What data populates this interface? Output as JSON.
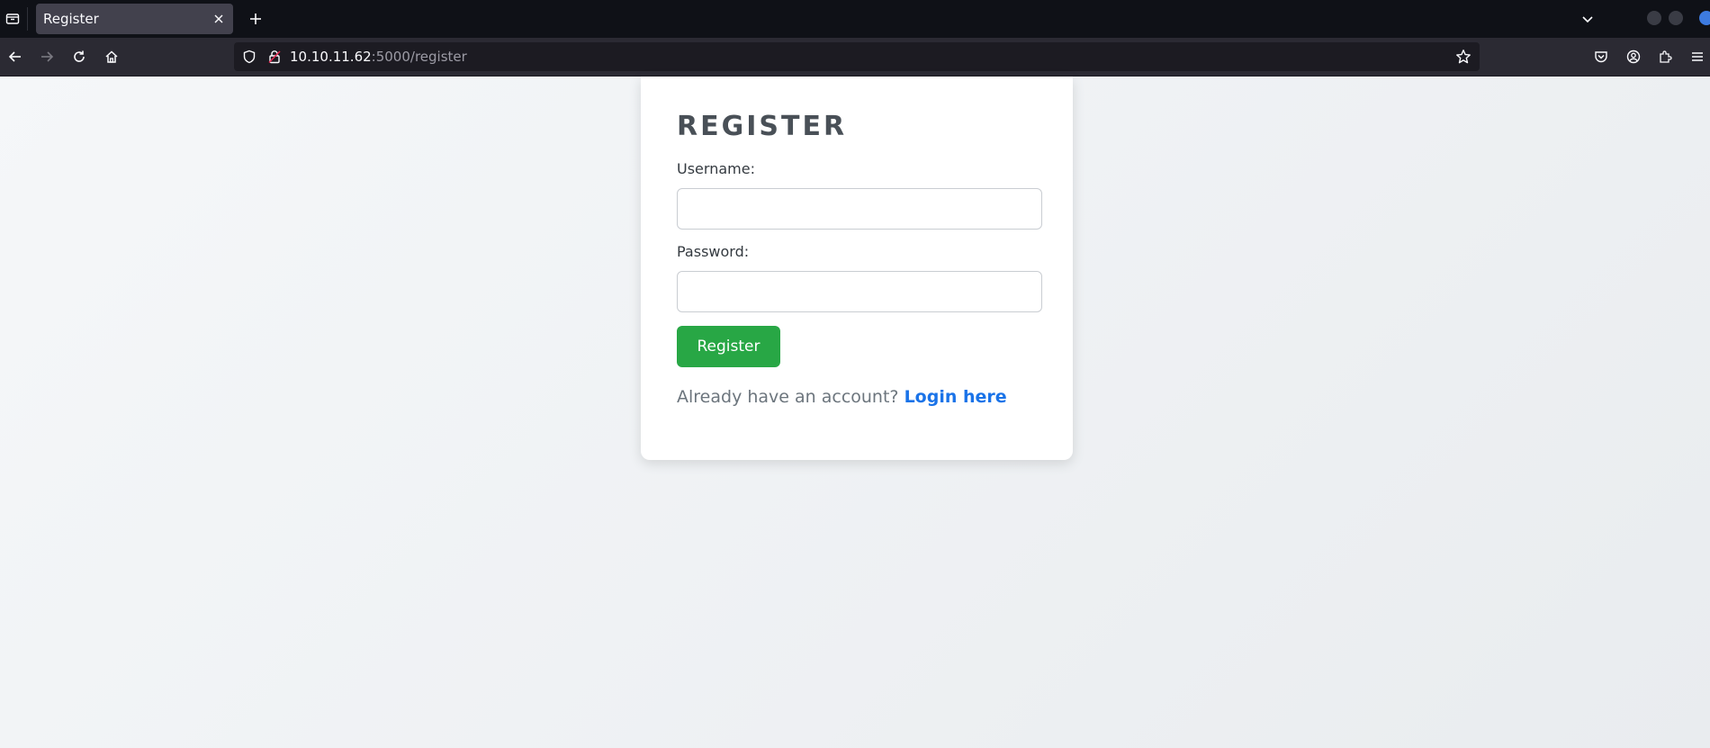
{
  "browser": {
    "tab_title": "Register",
    "url_host": "10.10.11.62",
    "url_rest": ":5000/register"
  },
  "form": {
    "heading": "REGISTER",
    "username_label": "Username:",
    "username_value": "",
    "password_label": "Password:",
    "password_value": "",
    "submit_label": "Register",
    "login_prompt": "Already have an account?",
    "login_link": "Login here"
  },
  "colors": {
    "accent_green": "#28a745",
    "link_blue": "#1a73e8",
    "heading_gray": "#495057"
  }
}
